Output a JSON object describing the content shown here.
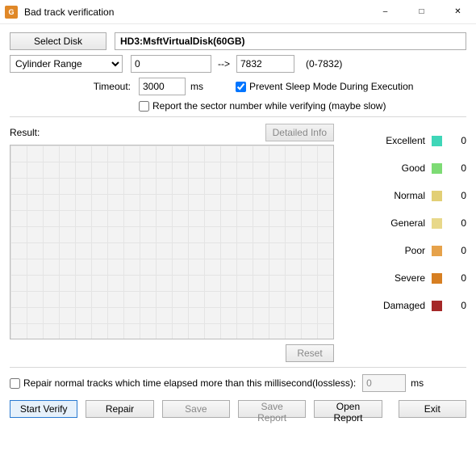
{
  "window": {
    "title": "Bad track verification"
  },
  "disk": {
    "select_button": "Select Disk",
    "path": "HD3:MsftVirtualDisk(60GB)"
  },
  "cylinder": {
    "label": "Cylinder Range",
    "from": "0",
    "arrow": "-->",
    "to": "7832",
    "range_hint": "(0-7832)"
  },
  "timeout": {
    "label": "Timeout:",
    "value": "3000",
    "unit": "ms"
  },
  "options": {
    "prevent_sleep_label": "Prevent Sleep Mode During Execution",
    "prevent_sleep_checked": true,
    "report_sector_label": "Report the sector number while verifying (maybe slow)",
    "report_sector_checked": false
  },
  "result": {
    "label": "Result:",
    "detailed_info": "Detailed Info",
    "reset": "Reset"
  },
  "legend": [
    {
      "label": "Excellent",
      "color": "#3fd6b8",
      "count": "0"
    },
    {
      "label": "Good",
      "color": "#7ddb74",
      "count": "0"
    },
    {
      "label": "Normal",
      "color": "#e2cf75",
      "count": "0"
    },
    {
      "label": "General",
      "color": "#e8d88a",
      "count": "0"
    },
    {
      "label": "Poor",
      "color": "#e6a24a",
      "count": "0"
    },
    {
      "label": "Severe",
      "color": "#d77f22",
      "count": "0"
    },
    {
      "label": "Damaged",
      "color": "#a52828",
      "count": "0"
    }
  ],
  "repair_option": {
    "label": "Repair normal tracks which time elapsed more than this millisecond(lossless):",
    "checked": false,
    "value": "0",
    "unit": "ms"
  },
  "buttons": {
    "start_verify": "Start Verify",
    "repair": "Repair",
    "save": "Save",
    "save_report": "Save Report",
    "open_report": "Open Report",
    "exit": "Exit"
  }
}
